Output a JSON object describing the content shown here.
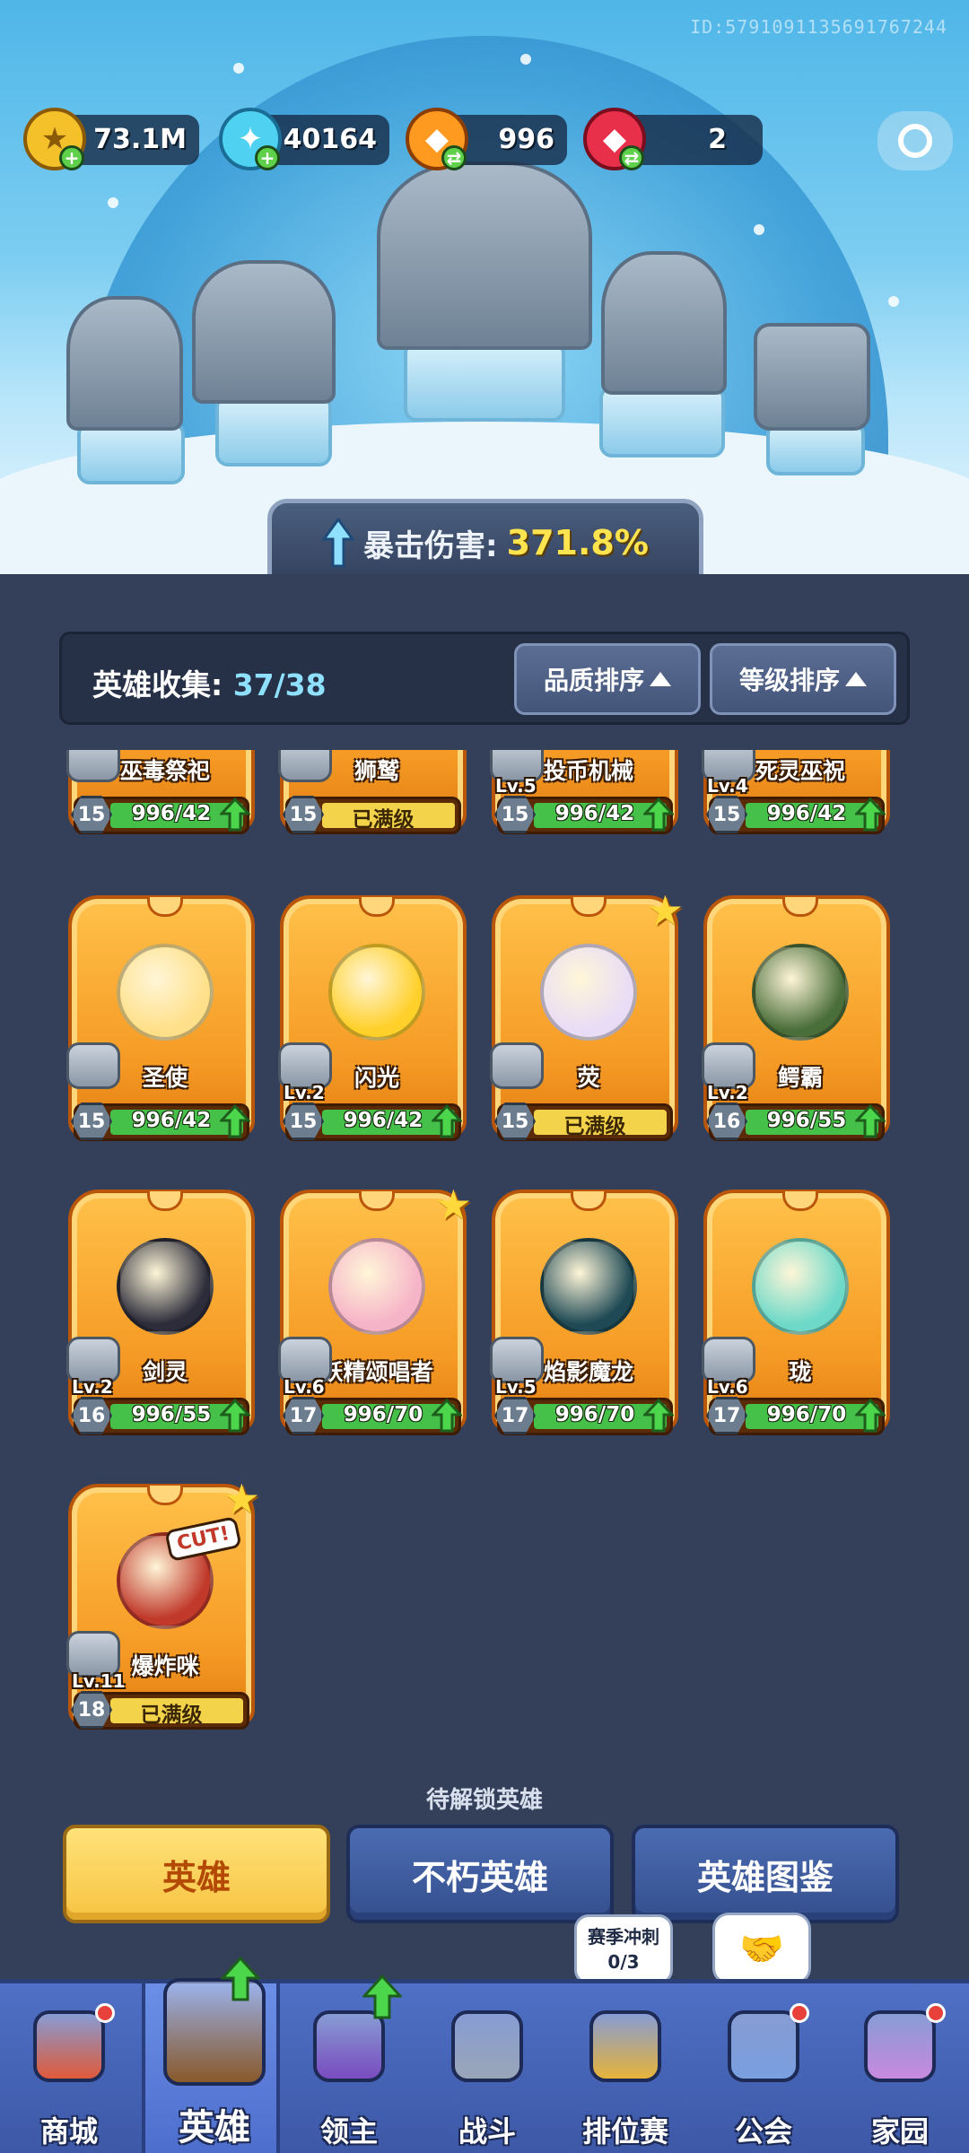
{
  "game_id": "ID:5791091135691767244",
  "resources": [
    {
      "name": "gold",
      "value": "73.1M",
      "icon": "gold-coin-icon",
      "color": "#f5c12b",
      "has_plus": true
    },
    {
      "name": "crystal",
      "value": "40164",
      "icon": "blue-crystal-icon",
      "color": "#4fd1f2",
      "has_plus": true
    },
    {
      "name": "orange_gem",
      "value": "996",
      "icon": "orange-gem-icon",
      "color": "#ff9a21",
      "has_plus": true
    },
    {
      "name": "red_gem",
      "value": "2",
      "icon": "red-gem-icon",
      "color": "#e8304a",
      "has_plus": true
    }
  ],
  "crit": {
    "label": "暴击伤害:",
    "value": "371.8%"
  },
  "collection": {
    "label": "英雄收集:",
    "count": "37/38"
  },
  "sort_buttons": [
    {
      "label": "品质排序"
    },
    {
      "label": "等级排序"
    }
  ],
  "heroes": [
    {
      "name": "巫毒祭祀",
      "level_hex": "15",
      "progress": "996/42",
      "max": false,
      "lv_tag": "",
      "star": false,
      "color": "#7a5cc0"
    },
    {
      "name": "狮鹫",
      "level_hex": "15",
      "progress": "已满级",
      "max": true,
      "lv_tag": "",
      "star": false,
      "color": "#6b5a3a"
    },
    {
      "name": "投币机械",
      "level_hex": "15",
      "progress": "996/42",
      "max": false,
      "lv_tag": "Lv.5",
      "star": false,
      "color": "#3d5a8a"
    },
    {
      "name": "死灵巫祝",
      "level_hex": "15",
      "progress": "996/42",
      "max": false,
      "lv_tag": "Lv.4",
      "star": false,
      "color": "#2f3c6e"
    },
    {
      "name": "圣使",
      "level_hex": "15",
      "progress": "996/42",
      "max": false,
      "lv_tag": "",
      "star": false,
      "color": "#ffe08a"
    },
    {
      "name": "闪光",
      "level_hex": "15",
      "progress": "996/42",
      "max": false,
      "lv_tag": "Lv.2",
      "star": false,
      "color": "#ffd02a"
    },
    {
      "name": "荧",
      "level_hex": "15",
      "progress": "已满级",
      "max": true,
      "lv_tag": "",
      "star": true,
      "color": "#e9dcf6"
    },
    {
      "name": "鳄霸",
      "level_hex": "16",
      "progress": "996/55",
      "max": false,
      "lv_tag": "Lv.2",
      "star": false,
      "color": "#4a6e3a"
    },
    {
      "name": "剑灵",
      "level_hex": "16",
      "progress": "996/55",
      "max": false,
      "lv_tag": "Lv.2",
      "star": false,
      "color": "#2c2c3a"
    },
    {
      "name": "妖精颂唱者",
      "level_hex": "17",
      "progress": "996/70",
      "max": false,
      "lv_tag": "Lv.6",
      "star": true,
      "color": "#f6b4c8"
    },
    {
      "name": "焰影魔龙",
      "level_hex": "17",
      "progress": "996/70",
      "max": false,
      "lv_tag": "Lv.5",
      "star": false,
      "color": "#1f4a55"
    },
    {
      "name": "珑",
      "level_hex": "17",
      "progress": "996/70",
      "max": false,
      "lv_tag": "Lv.6",
      "star": false,
      "color": "#6ed9c8"
    },
    {
      "name": "爆炸咪",
      "level_hex": "18",
      "progress": "已满级",
      "max": true,
      "lv_tag": "Lv.11",
      "star": true,
      "color": "#c0392b",
      "badge": "CUT!"
    }
  ],
  "unlock_label": "待解锁英雄",
  "tabs": [
    {
      "label": "英雄",
      "active": true
    },
    {
      "label": "不朽英雄",
      "active": false
    },
    {
      "label": "英雄图鉴",
      "active": false
    }
  ],
  "season_bubble": {
    "title": "赛季冲刺",
    "progress": "0/3"
  },
  "nav": [
    {
      "label": "商城",
      "icon": "shop-icon",
      "color": "#e05a3a",
      "red_dot": true,
      "green_up": false,
      "active": false
    },
    {
      "label": "英雄",
      "icon": "hero-card-icon",
      "color": "#8a5a2a",
      "red_dot": false,
      "green_up": true,
      "active": true
    },
    {
      "label": "领主",
      "icon": "lord-banner-icon",
      "color": "#7a4cc0",
      "red_dot": false,
      "green_up": true,
      "active": false
    },
    {
      "label": "战斗",
      "icon": "crossed-swords-icon",
      "color": "#9aa6b8",
      "red_dot": false,
      "green_up": false,
      "active": false
    },
    {
      "label": "排位赛",
      "icon": "rank-shield-icon",
      "color": "#e8b43a",
      "red_dot": false,
      "green_up": false,
      "active": false
    },
    {
      "label": "公会",
      "icon": "guild-castle-icon",
      "color": "#7aa0e0",
      "red_dot": true,
      "green_up": false,
      "active": false
    },
    {
      "label": "家园",
      "icon": "home-castle-icon",
      "color": "#c98ae0",
      "red_dot": true,
      "green_up": false,
      "active": false
    }
  ]
}
